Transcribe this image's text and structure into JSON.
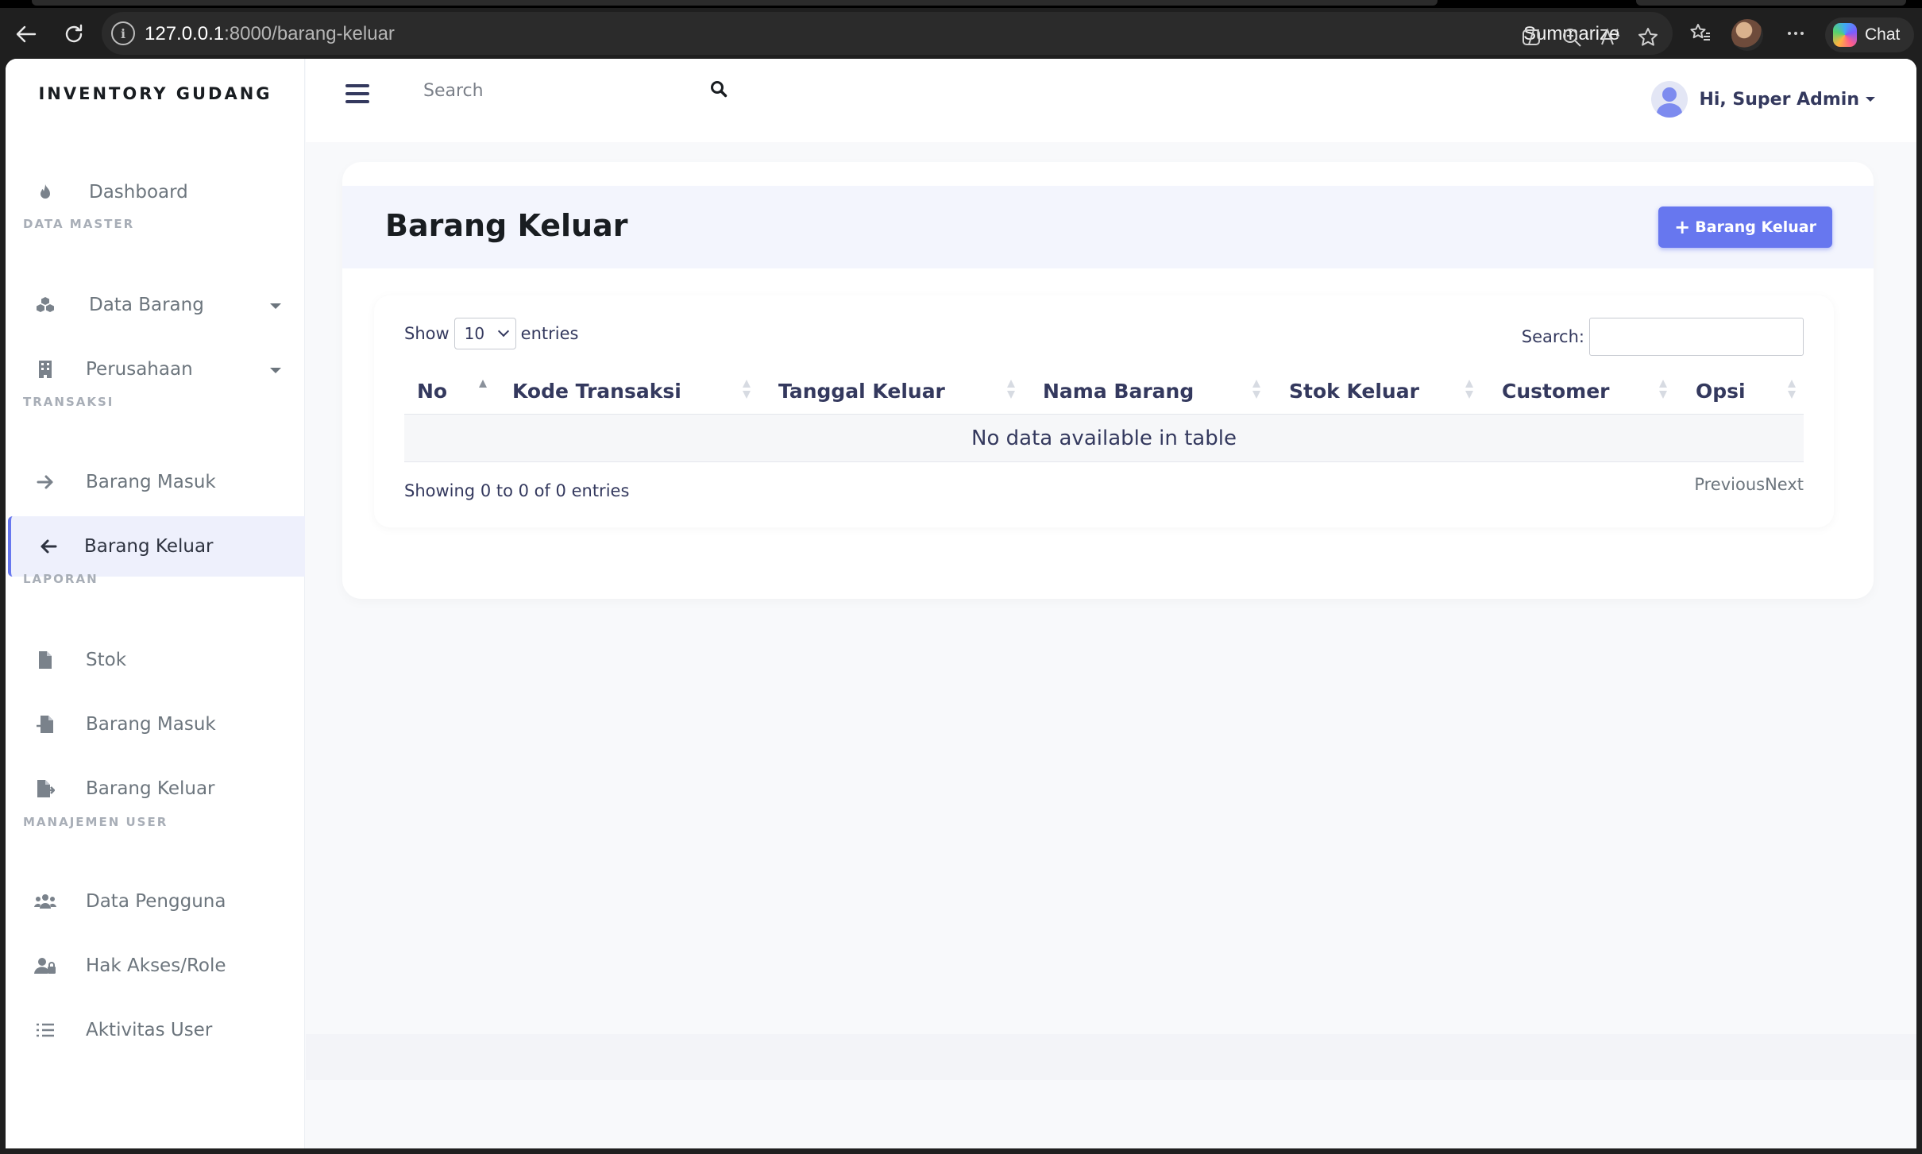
{
  "browser": {
    "url_host": "127.0.0.1",
    "url_path": ":8000/barang-keluar",
    "summarize_label": "Summarize",
    "chat_label": "Chat"
  },
  "sidebar": {
    "brand": "INVENTORY GUDANG",
    "dashboard": "Dashboard",
    "headers": {
      "data_master": "DATA MASTER",
      "transaksi": "TRANSAKSI",
      "laporan": "LAPORAN",
      "manajemen_user": "MANAJEMEN USER"
    },
    "data_barang": "Data Barang",
    "perusahaan": "Perusahaan",
    "barang_masuk": "Barang Masuk",
    "barang_keluar": "Barang Keluar",
    "laporan_stok": "Stok",
    "laporan_barang_masuk": "Barang Masuk",
    "laporan_barang_keluar": "Barang Keluar",
    "data_pengguna": "Data Pengguna",
    "hak_akses": "Hak Akses/Role",
    "aktivitas_user": "Aktivitas User",
    "active_item": "Barang Keluar"
  },
  "navbar": {
    "search_placeholder": "Search",
    "user_greeting": "Hi, Super Admin"
  },
  "page": {
    "title": "Barang Keluar",
    "add_button": "Barang Keluar"
  },
  "table": {
    "show_label": "Show",
    "entries_value": "10",
    "entries_label": "entries",
    "search_label": "Search:",
    "columns": [
      "No",
      "Kode Transaksi",
      "Tanggal Keluar",
      "Nama Barang",
      "Stok Keluar",
      "Customer",
      "Opsi"
    ],
    "sorted_column": "No",
    "empty_message": "No data available in table",
    "info": "Showing 0 to 0 of 0 entries",
    "previous": "Previous",
    "next": "Next"
  },
  "colors": {
    "primary": "#6777ef",
    "text": "#34395e",
    "sidebar_active_bg": "#eef0fc"
  }
}
